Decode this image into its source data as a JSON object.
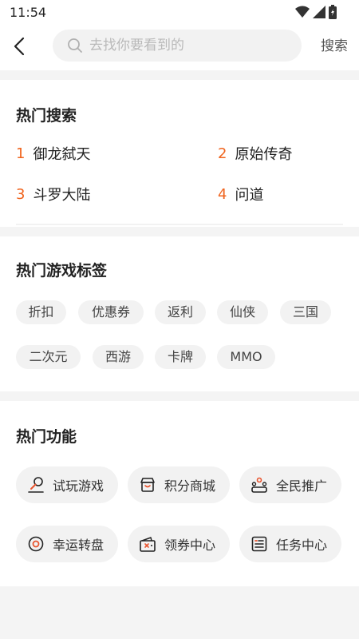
{
  "status": {
    "time": "11:54"
  },
  "search": {
    "placeholder": "去找你要看到的",
    "button": "搜索"
  },
  "hot_search": {
    "title": "热门搜索",
    "items": [
      {
        "rank": "1",
        "label": "御龙弑天"
      },
      {
        "rank": "2",
        "label": "原始传奇"
      },
      {
        "rank": "3",
        "label": "斗罗大陆"
      },
      {
        "rank": "4",
        "label": "问道"
      }
    ]
  },
  "hot_tags": {
    "title": "热门游戏标签",
    "items": [
      "折扣",
      "优惠券",
      "返利",
      "仙侠",
      "三国",
      "二次元",
      "西游",
      "卡牌",
      "MMO"
    ]
  },
  "hot_functions": {
    "title": "热门功能",
    "items": [
      {
        "label": "试玩游戏",
        "icon": "trial-game-icon"
      },
      {
        "label": "积分商城",
        "icon": "shop-icon"
      },
      {
        "label": "全民推广",
        "icon": "promotion-icon"
      },
      {
        "label": "幸运转盘",
        "icon": "lucky-wheel-icon"
      },
      {
        "label": "领券中心",
        "icon": "coupon-icon"
      },
      {
        "label": "任务中心",
        "icon": "task-icon"
      }
    ]
  },
  "colors": {
    "accent": "#f0641e",
    "chip_bg": "#f2f2f2"
  }
}
